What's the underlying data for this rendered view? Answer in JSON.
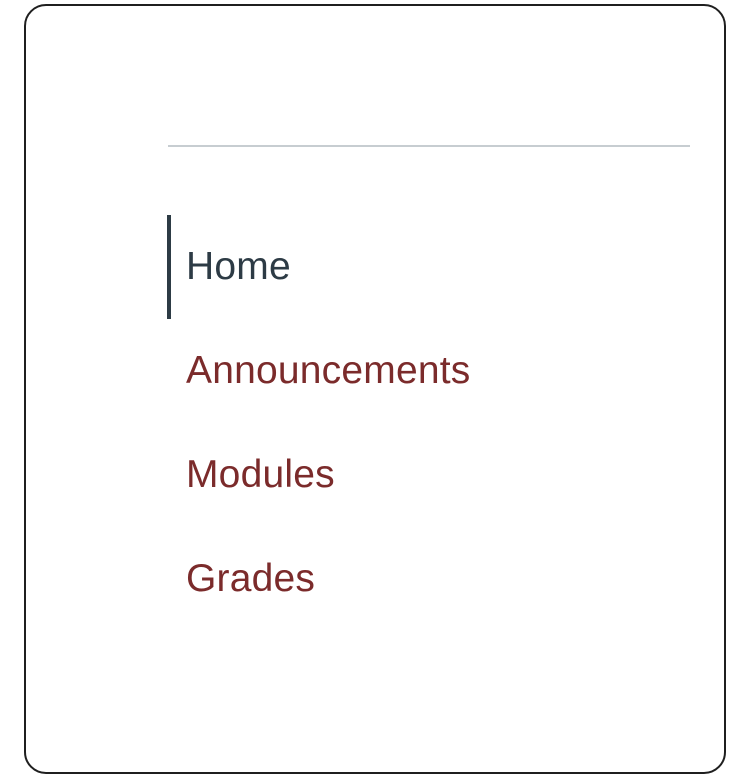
{
  "course_nav": {
    "active_index": 0,
    "items": [
      {
        "label": "Home"
      },
      {
        "label": "Announcements"
      },
      {
        "label": "Modules"
      },
      {
        "label": "Grades"
      }
    ]
  },
  "colors": {
    "active_text": "#2d3b45",
    "link_text": "#7b2b2b",
    "divider": "#c7cdd1",
    "frame_border": "#1f1f1f"
  }
}
